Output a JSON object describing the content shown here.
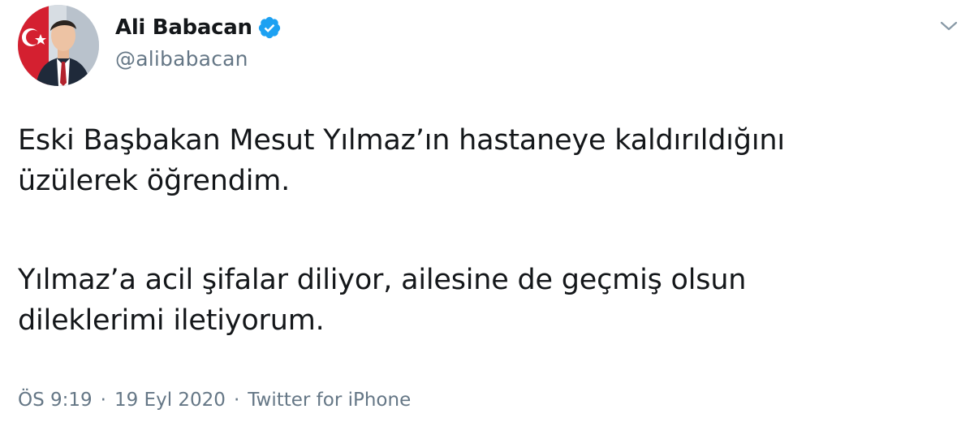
{
  "tweet": {
    "author": {
      "display_name": "Ali Babacan",
      "handle": "@alibabacan",
      "verified": true,
      "verified_icon": "verified-badge-icon"
    },
    "text": {
      "paragraph_1_line_1": "Eski Başbakan Mesut Yılmaz’ın hastaneye kaldırıldığını",
      "paragraph_1_line_2": "üzülerek öğrendim.",
      "paragraph_2_line_1": "Yılmaz’a acil şifalar diliyor, ailesine de geçmiş olsun",
      "paragraph_2_line_2": "dileklerimi iletiyorum."
    },
    "meta": {
      "time": "ÖS 9:19",
      "separator": "·",
      "date": "19 Eyl 2020",
      "source": "Twitter for iPhone"
    },
    "menu_icon": "chevron-down-icon"
  },
  "colors": {
    "text_primary": "#14171a",
    "text_secondary": "#657786",
    "verified_blue": "#1da1f2",
    "background": "#ffffff"
  }
}
